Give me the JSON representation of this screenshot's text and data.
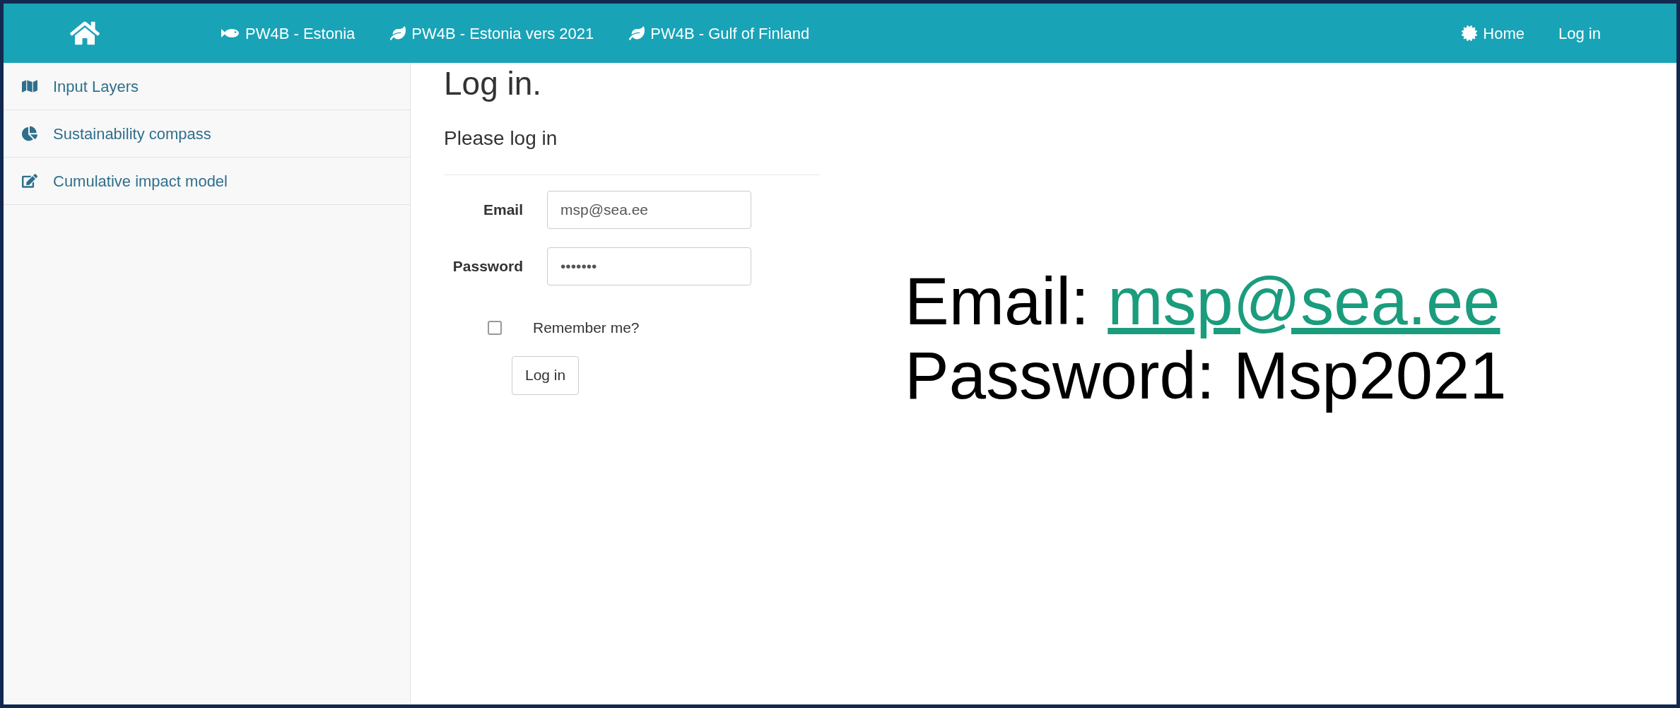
{
  "navbar": {
    "links": [
      {
        "kind": "fish",
        "label": "PW4B - Estonia"
      },
      {
        "kind": "leaf",
        "label": "PW4B - Estonia vers 2021"
      },
      {
        "kind": "leaf",
        "label": "PW4B - Gulf of Finland"
      }
    ],
    "right_links": [
      {
        "kind": "badge",
        "label": "Home"
      },
      {
        "kind": "plain",
        "label": "Log in"
      }
    ]
  },
  "sidebar": {
    "items": [
      {
        "kind": "map",
        "label": "Input Layers"
      },
      {
        "kind": "pie",
        "label": "Sustainability compass"
      },
      {
        "kind": "edit",
        "label": "Cumulative impact model"
      }
    ]
  },
  "form": {
    "title": "Log in.",
    "subtitle": "Please log in",
    "fields": [
      {
        "label": "Email",
        "value": "msp@sea.ee"
      },
      {
        "label": "Password",
        "value": "•••••••"
      }
    ],
    "remember": {
      "label": "Remember me?",
      "checked": false
    },
    "submit": "Log in"
  },
  "note": {
    "email_label": "Email: ",
    "email_link": "msp@sea.ee",
    "password_line": "Password: Msp2021"
  }
}
